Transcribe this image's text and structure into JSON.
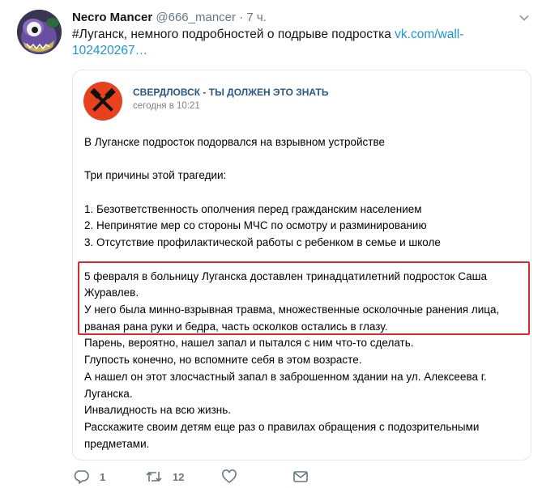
{
  "tweet": {
    "author_name": "Necro Mancer",
    "handle": "@666_mancer",
    "separator": "·",
    "time": "7 ч.",
    "text_prefix": "#Луганск, немного подробностей о подрыве подростка ",
    "text_link": "vk.com/wall-102420267…"
  },
  "card": {
    "source_name": "СВЕРДЛОВСК - ТЫ ДОЛЖЕН ЭТО ЗНАТЬ",
    "source_time": "сегодня в 10:21",
    "paragraph1": "В Луганске подросток подорвался на взрывном устройстве",
    "paragraph2": "Три причины этой трагедии:",
    "reasons": [
      "1. Безответственность ополчения перед гражданским населением",
      "2. Непринятие мер со стороны МЧС по осмотру и разминированию",
      "3. Отсутствие профилактической работы с ребенком в семье и школе"
    ],
    "details": [
      "5 февраля в больницу Луганска доставлен тринадцатилетний подросток Саша Журавлев.",
      "У него была минно-взрывная травма, множественные осколочные ранения лица, рваная рана руки и бедра, часть осколков остались в глазу.",
      "Парень, вероятно, нашел запал и пытался с ним что-то сделать.",
      "Глупость конечно, но вспомните себя в этом возрасте.",
      "А нашел он этот злосчастный запал в заброшенном здании на ул. Алексеева г. Луганска.",
      "Инвалидность на всю жизнь.",
      "Расскажите своим детям еще раз о правилах обращения с подозрительными предметами."
    ]
  },
  "actions": {
    "reply_count": "1",
    "retweet_count": "12",
    "like_count": "",
    "icons": [
      "reply-icon",
      "retweet-icon",
      "like-icon",
      "message-icon"
    ]
  },
  "colors": {
    "link": "#1b95e0",
    "vk_name": "#2a5885",
    "highlight": "#d62a2f",
    "muted": "#657786"
  }
}
